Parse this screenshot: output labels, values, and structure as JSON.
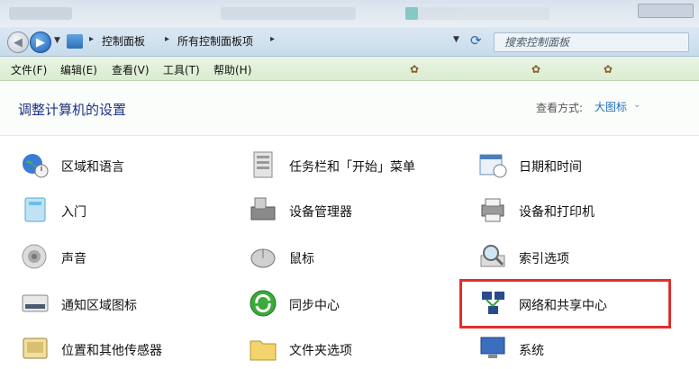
{
  "address_bar": {
    "crumbs": [
      "控制面板",
      "所有控制面板项"
    ],
    "search_placeholder": "搜索控制面板"
  },
  "menu": [
    "文件(F)",
    "编辑(E)",
    "查看(V)",
    "工具(T)",
    "帮助(H)"
  ],
  "header": {
    "title": "调整计算机的设置",
    "view_label": "查看方式:",
    "view_value": "大图标"
  },
  "items": [
    "区域和语言",
    "任务栏和「开始」菜单",
    "日期和时间",
    "入门",
    "设备管理器",
    "设备和打印机",
    "声音",
    "鼠标",
    "索引选项",
    "通知区域图标",
    "同步中心",
    "网络和共享中心",
    "位置和其他传感器",
    "文件夹选项",
    "系统"
  ],
  "highlight_color": "#e0302c",
  "accent_color": "#1e3287"
}
